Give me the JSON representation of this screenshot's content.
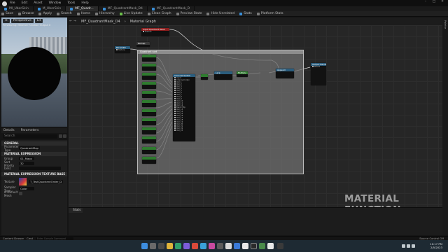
{
  "menu": [
    "File",
    "Edit",
    "Asset",
    "Window",
    "Tools",
    "Help"
  ],
  "tabs": [
    {
      "label": "MI_UberSkin",
      "active": false
    },
    {
      "label": "M_UberSkin",
      "active": false
    },
    {
      "label": "MF_Quadr...",
      "active": true
    },
    {
      "label": "MF_QuadrantMask_D4",
      "active": false
    },
    {
      "label": "MF_QuadrantMask_D",
      "active": false
    }
  ],
  "toolbar": [
    "Save",
    "Browse",
    "Apply",
    "Search",
    "Home",
    "Hierarchy",
    "Live Update",
    "Clean Graph",
    "Preview State",
    "Hide Unrelated",
    "Stats",
    "Platform Stats"
  ],
  "viewport": {
    "mode": "Perspective",
    "lit": "Lit",
    "info": "Previewing: Material Function Output 0"
  },
  "details": {
    "tabs": [
      "Details",
      "Parameters"
    ],
    "search_placeholder": "Search",
    "sections": [
      {
        "title": "GENERAL",
        "props": [
          {
            "k": "Parameter Type",
            "v": "QuadrantMap"
          }
        ]
      },
      {
        "title": "MATERIAL EXPRESSION",
        "props": [
          {
            "k": "Group",
            "v": "01_Maps"
          },
          {
            "k": "Sort Priority",
            "v": "32"
          },
          {
            "k": "Desc",
            "v": ""
          }
        ]
      },
      {
        "title": "MATERIAL EXPRESSION TEXTURE BASE",
        "props": [
          {
            "k": "Texture",
            "v": "T_TestQuadrantOrder_D"
          },
          {
            "k": "Sampler Type",
            "v": "Color"
          },
          {
            "k": "Is Default Mesh",
            "v": ""
          }
        ]
      }
    ]
  },
  "graph": {
    "breadcrumb": "MF_QuadrantMask_D4",
    "sub_breadcrumb": "Material Graph",
    "right_strip": "Palette",
    "watermark": "MATERIAL FUNCTION",
    "nodes": {
      "input_top": {
        "title": "Input Quadrant Mask",
        "pin": "Texture"
      },
      "param": {
        "title": "Param2D",
        "pin": "Texture"
      },
      "remap": {
        "title": "Remap"
      },
      "comment": {
        "title": "Quadrant sort"
      },
      "big": {
        "title": "Channel Switch",
        "pins": [
          "Input",
          "Channel Index",
          "Out_1",
          "Out_2",
          "Out_3",
          "Out_4",
          "Out_5",
          "Out_6",
          "Out_7",
          "Out_8",
          "Out_9",
          "Out_10",
          "Out_11",
          "Out_12",
          "Blend Flip",
          "Out_13",
          "Out_14",
          "Out_15",
          "Out_16",
          "Out_17",
          "Out_18",
          "Out_19",
          "Out_20",
          "Out_21",
          "Out_22",
          "Out_23"
        ]
      },
      "lerp": {
        "title": "Lerp"
      },
      "mult": {
        "title": "Multiply"
      },
      "output": {
        "title": "Output Result",
        "pin": "Result"
      },
      "append": {
        "title": "Append"
      }
    }
  },
  "stats": {
    "label": "Stats"
  },
  "statusbar": {
    "drawer": "Content Drawer",
    "cmd": "Cmd",
    "cmd_placeholder": "Enter Console Command",
    "source": "Source Control Off"
  },
  "clock": {
    "time": "10:17 PM",
    "date": "2/5/2023"
  },
  "colors": {
    "accent": "#3a8fd8",
    "node_green": "#2f7b2f",
    "node_red": "#8e1e1e",
    "node_blue": "#2b5d7d"
  }
}
